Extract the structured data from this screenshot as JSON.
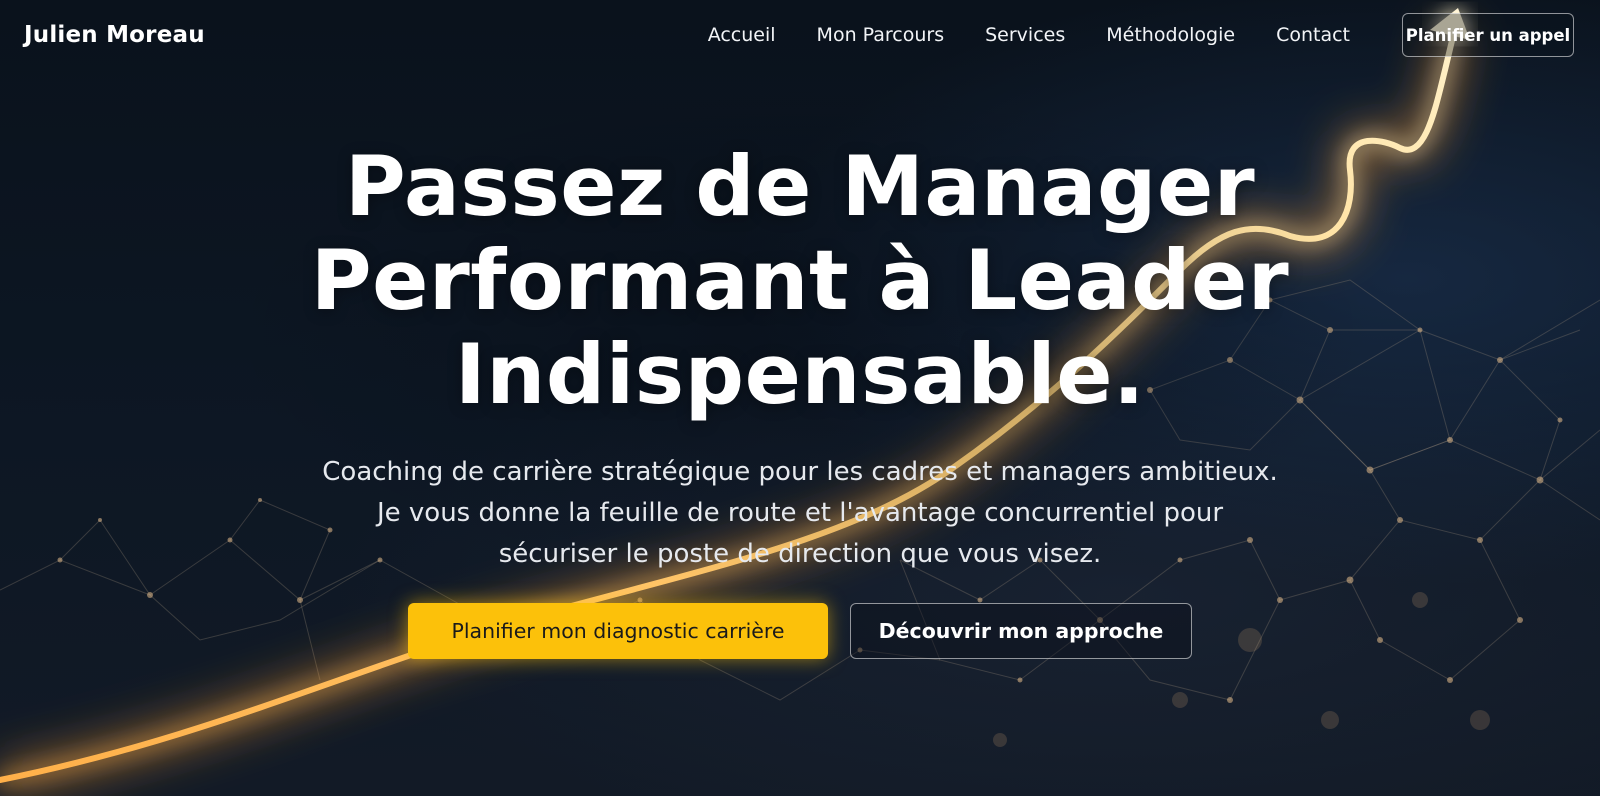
{
  "nav": {
    "brand": "Julien Moreau",
    "links": [
      "Accueil",
      "Mon Parcours",
      "Services",
      "Méthodologie",
      "Contact"
    ],
    "cta_label": "Planifier un appel"
  },
  "hero": {
    "headline_lines": [
      "Passez de Manager",
      "Performant à Leader",
      "Indispensable."
    ],
    "subtitle_lines": [
      "Coaching de carrière stratégique pour les cadres et managers ambitieux.",
      "Je vous donne la feuille de route et l'avantage concurrentiel pour",
      "sécuriser le poste de direction que vous visez."
    ],
    "primary_button": "Planifier mon diagnostic carrière",
    "secondary_button": "Découvrir mon approche"
  },
  "colors": {
    "background": "#0b1420",
    "accent": "#fcc10a",
    "glow": "#ffb347",
    "text": "#ffffff"
  },
  "icons": {
    "growth_arrow": "glowing-growth-arrow"
  }
}
